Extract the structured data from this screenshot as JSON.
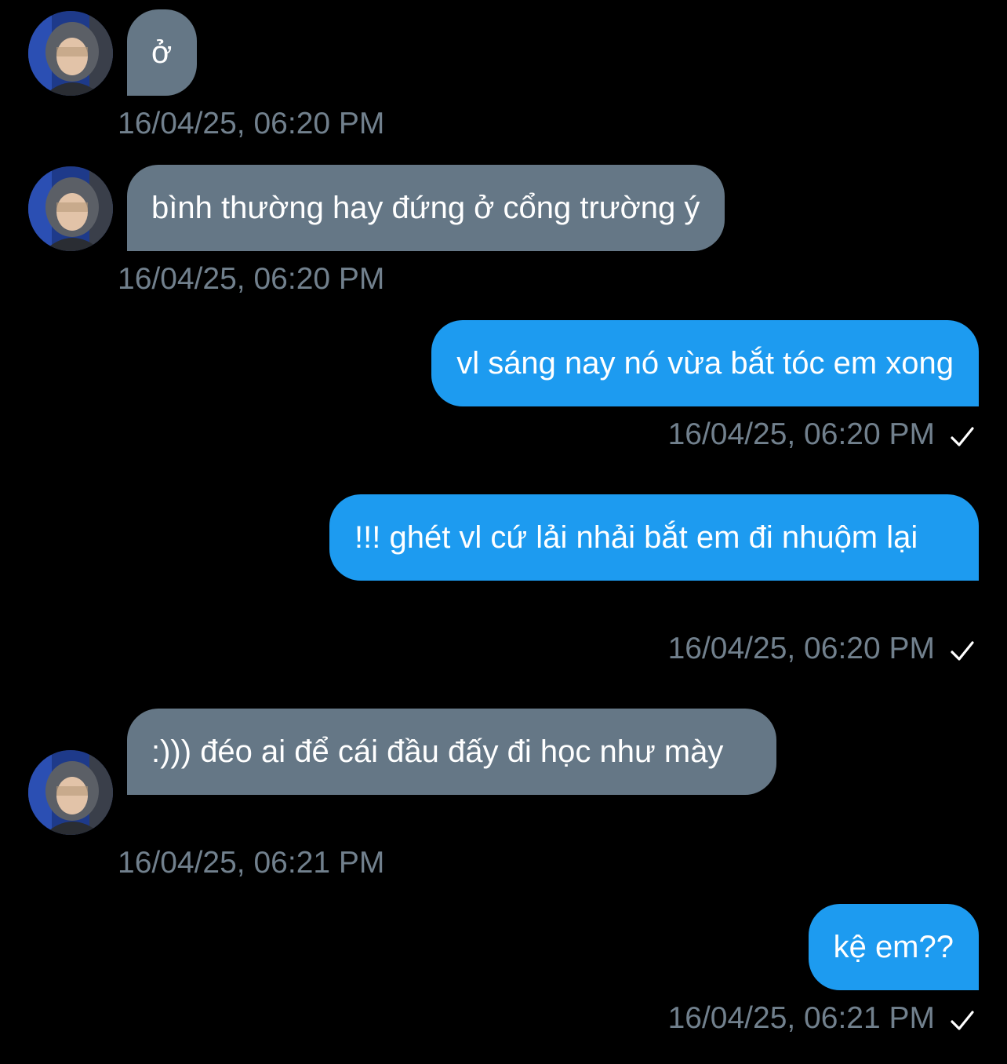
{
  "conversation": {
    "messages": [
      {
        "direction": "incoming",
        "text": "ở",
        "timestamp": "16/04/25, 06:20 PM"
      },
      {
        "direction": "incoming",
        "text": "bình thường hay đứng ở cổng trường ý",
        "timestamp": "16/04/25, 06:20 PM"
      },
      {
        "direction": "outgoing",
        "text": "vl sáng nay nó vừa bắt tóc em xong",
        "timestamp": "16/04/25, 06:20 PM",
        "status_icon": "check-icon"
      },
      {
        "direction": "outgoing",
        "text": "!!! ghét vl cứ lải nhải bắt em đi nhuộm lại",
        "timestamp": "16/04/25, 06:20 PM",
        "status_icon": "check-icon"
      },
      {
        "direction": "incoming",
        "text": ":))) đéo ai để cái đầu đấy đi học như mày",
        "timestamp": "16/04/25, 06:21 PM"
      },
      {
        "direction": "outgoing",
        "text": "kệ em??",
        "timestamp": "16/04/25, 06:21 PM",
        "status_icon": "check-icon"
      }
    ],
    "avatar_icon": "user-avatar-photo"
  },
  "colors": {
    "background": "#000000",
    "incoming_bubble": "#657786",
    "outgoing_bubble": "#1d9bf0",
    "timestamp": "#71808d",
    "check": "#ffffff"
  }
}
